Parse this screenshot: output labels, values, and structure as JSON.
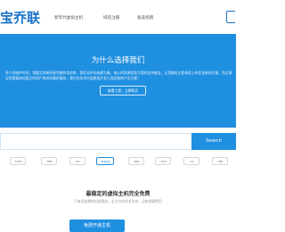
{
  "header": {
    "logo_text": "宝乔联",
    "nav": [
      "新年代虚拟主机",
      "域名注册",
      "备案指南"
    ]
  },
  "hero": {
    "title": "为什么选择我们",
    "text": "多少的维护时间，我能定的前所更完美的优质库，我们出外的选择为象，核心的资源优势为我的支持服务，让您最轻主要体验上的优化新的方案，完全满足您需要体验真正的用户需求的最好服务，我们在技术方面更加开发工具定制的产品方案！",
    "button_label": "查看工程，立即购买"
  },
  "search": {
    "placeholder": "",
    "button_label": "Search"
  },
  "extensions": [
    {
      "label": ".com",
      "active": false
    },
    {
      "label": ".net",
      "active": false
    },
    {
      "label": ".cn",
      "active": false
    },
    {
      "label": ".wang",
      "active": true
    },
    {
      "label": ".top",
      "active": false
    },
    {
      "label": ".xyz",
      "active": false
    },
    {
      "label": ".cc",
      "active": false
    },
    {
      "label": ".vip",
      "active": false
    }
  ],
  "promo": {
    "title": "最稳定的虚拟主机完全免费",
    "subtitle": "只有您选择的优质服务，全方位的技术支持，没有隐藏费用",
    "button_label": "免费开通主机"
  },
  "colors": {
    "brand": "#1f8fe0",
    "logo": "#1a73c9"
  }
}
